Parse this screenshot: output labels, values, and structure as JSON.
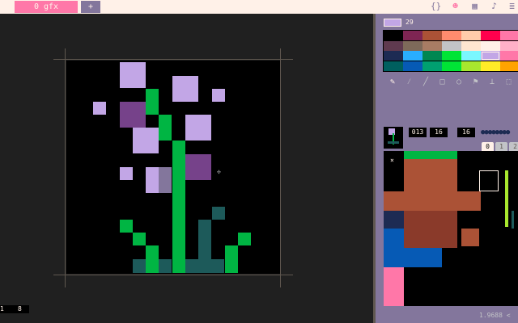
{
  "tabs": [
    {
      "label": "0 gfx",
      "active": true
    },
    {
      "label": "+",
      "active": false
    }
  ],
  "toolbar_icons": [
    {
      "name": "code-icon",
      "glyph": "{}",
      "active": false
    },
    {
      "name": "sprite-icon",
      "glyph": "☻",
      "active": true
    },
    {
      "name": "map-icon",
      "glyph": "▦",
      "active": false
    },
    {
      "name": "sfx-icon",
      "glyph": "♪",
      "active": false
    },
    {
      "name": "music-icon",
      "glyph": "≣",
      "active": false
    }
  ],
  "status": {
    "x": "1",
    "y": "8"
  },
  "palette": {
    "selected_index": "29",
    "selected_color": "#c2a6e6",
    "colors": [
      [
        "#000000",
        "#7e2553",
        "#ab5236",
        "#ff8c6e",
        "#ffccaa",
        "#ff004d",
        "#ff77a8"
      ],
      [
        "#5f3a4f",
        "#7e6a5a",
        "#a87c64",
        "#c2c3c7",
        "#ffe6d0",
        "#fff1e8",
        "#ffb0c8"
      ],
      [
        "#1d2b53",
        "#29adff",
        "#008751",
        "#00e436",
        "#7af7ff",
        "#c2a6e6",
        "#ff77a8"
      ],
      [
        "#005f5f",
        "#065ab5",
        "#00a070",
        "#00e436",
        "#a8e72e",
        "#ffec27",
        "#ffa300"
      ]
    ]
  },
  "tools": [
    {
      "name": "pencil-tool-icon",
      "glyph": "✎",
      "active": true
    },
    {
      "name": "brush-tool-icon",
      "glyph": "⁄",
      "active": false
    },
    {
      "name": "line-tool-icon",
      "glyph": "╱",
      "active": false
    },
    {
      "name": "rect-tool-icon",
      "glyph": "□",
      "active": false
    },
    {
      "name": "circle-tool-icon",
      "glyph": "○",
      "active": false
    },
    {
      "name": "fill-tool-icon",
      "glyph": "⚑",
      "active": false
    },
    {
      "name": "stamp-tool-icon",
      "glyph": "⊥",
      "active": false
    },
    {
      "name": "select-tool-icon",
      "glyph": "⬚",
      "active": false
    }
  ],
  "sprite": {
    "number": "013",
    "width": "16",
    "height": "16"
  },
  "sprite_pages": [
    "0",
    "1",
    "2"
  ],
  "footer": "1.9688 <"
}
